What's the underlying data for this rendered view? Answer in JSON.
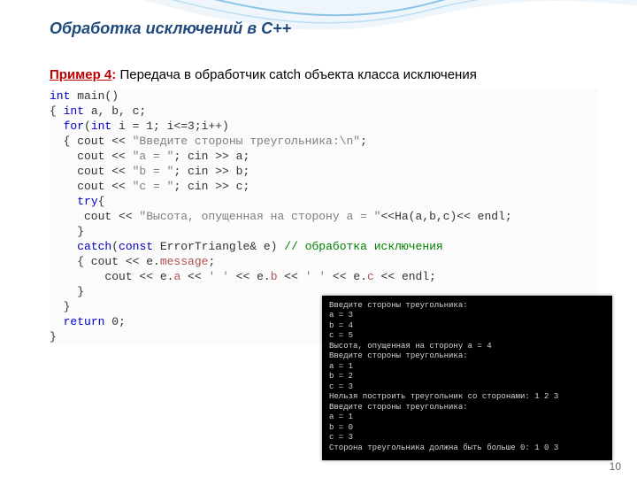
{
  "title": "Обработка исключений в С++",
  "example": {
    "label": "Пример 4",
    "colon": ":",
    "text": "  Передача в обработчик catch объекта  класса исключения"
  },
  "code": {
    "l1a": "int",
    "l1b": " main()",
    "l2a": "{ ",
    "l2b": "int",
    "l2c": " a, b, c;",
    "l3a": "  ",
    "l3b": "for",
    "l3c": "(",
    "l3d": "int",
    "l3e": " i = 1; i<=3;i++)",
    "l4a": "  { cout << ",
    "l4b": "\"Введите стороны треугольника:\\n\"",
    "l4c": ";",
    "l5a": "    cout << ",
    "l5b": "\"a = \"",
    "l5c": "; cin >> a;",
    "l6a": "    cout << ",
    "l6b": "\"b = \"",
    "l6c": "; cin >> b;",
    "l7a": "    cout << ",
    "l7b": "\"c = \"",
    "l7c": "; cin >> c;",
    "l8a": "    ",
    "l8b": "try",
    "l8c": "{",
    "l9a": "     cout << ",
    "l9b": "\"Высота, опущенная на сторону a = \"",
    "l9c": "<<Ha(a,b,c)<< endl;",
    "l10": "    }",
    "l11a": "    ",
    "l11b": "catch",
    "l11c": "(",
    "l11d": "const",
    "l11e": " ErrorTriangle& e) ",
    "l11f": "// обработка исключения",
    "l12a": "    { cout << e.",
    "l12b": "message",
    "l12c": ";",
    "l13a": "        cout << e.",
    "l13b": "a",
    "l13c": " << ",
    "l13d": "' '",
    "l13e": " << e.",
    "l13f": "b",
    "l13g": " << ",
    "l13h": "' '",
    "l13i": " << e.",
    "l13j": "c",
    "l13k": " << endl;",
    "l14": "    }",
    "l15": "  }",
    "l16a": "  ",
    "l16b": "return",
    "l16c": " 0;",
    "l17": "}"
  },
  "console": "Введите стороны треугольника:\na = 3\nb = 4\nc = 5\nВысота, опущенная на сторону a = 4\nВведите стороны треугольника:\na = 1\nb = 2\nc = 3\nНельзя построить треугольник со сторонами: 1 2 3\nВведите стороны треугольника:\na = 1\nb = 0\nc = 3\nСторона треугольника должна быть больше 0: 1 0 3",
  "page": "10"
}
